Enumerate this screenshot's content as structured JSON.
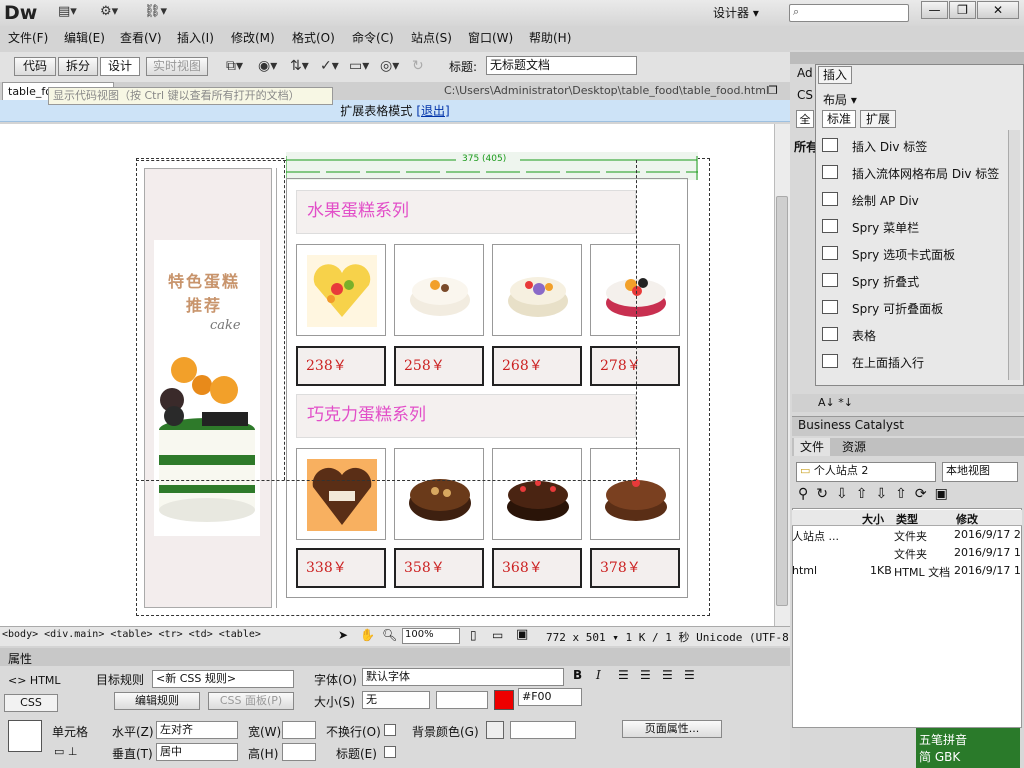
{
  "app": {
    "logo": "Dw",
    "workspace": "设计器 ▾",
    "search_placeholder": "⌕"
  },
  "window_buttons": {
    "minimize": "—",
    "restore": "❐",
    "close": "✕"
  },
  "menu": [
    "文件(F)",
    "编辑(E)",
    "查看(V)",
    "插入(I)",
    "修改(M)",
    "格式(O)",
    "命令(C)",
    "站点(S)",
    "窗口(W)",
    "帮助(H)"
  ],
  "view_buttons": {
    "code": "代码",
    "split": "拆分",
    "design": "设计",
    "live": "实时视图"
  },
  "title_field": {
    "label": "标题:",
    "value": "无标题文档"
  },
  "doc_tab": {
    "name": "table_food.html",
    "close": "×"
  },
  "tooltip": "显示代码视图（按 Ctrl 键以查看所有打开的文档）",
  "file_path": "C:\\Users\\Administrator\\Desktop\\table_food\\table_food.html",
  "expanded_bar": {
    "text": "扩展表格模式",
    "exit": "[退出]"
  },
  "ruler_label": "375 (405)",
  "promo": {
    "line1": "特色蛋糕",
    "line2": "推荐",
    "line3": "cake"
  },
  "sections": [
    {
      "title": "水果蛋糕系列",
      "prices": [
        "238￥",
        "258￥",
        "268￥",
        "278￥"
      ]
    },
    {
      "title": "巧克力蛋糕系列",
      "prices": [
        "338￥",
        "358￥",
        "368￥",
        "378￥"
      ]
    }
  ],
  "status": {
    "tag_path": "<body> <div.main> <table> <tr> <td> <table>",
    "zoom": "100%",
    "size": "772 x 501 ▾  1 K / 1 秒  Unicode (UTF-8)"
  },
  "properties": {
    "header": "属性",
    "html_tab": "<> HTML",
    "css_tab": "CSS",
    "target_rule_label": "目标规则",
    "target_rule_value": "<新 CSS 规则>",
    "edit_rule": "编辑规则",
    "css_panel": "CSS 面板(P)",
    "font_label": "字体(O)",
    "font_value": "默认字体",
    "size_label": "大小(S)",
    "size_value": "无",
    "color_value": "#F00",
    "cell_label": "单元格",
    "horz_label": "水平(Z)",
    "horz_value": "左对齐",
    "vert_label": "垂直(T)",
    "vert_value": "居中",
    "width_label": "宽(W)",
    "height_label": "高(H)",
    "nowrap_label": "不换行(O)",
    "header_label": "标题(E)",
    "bg_label": "背景颜色(G)",
    "page_props": "页面属性..."
  },
  "insert_panel": {
    "tab": "插入",
    "category": "布局 ▾",
    "mode_standard": "标准",
    "mode_expanded": "扩展",
    "items": [
      "插入 Div 标签",
      "插入流体网格布局 Div 标签",
      "绘制 AP Div",
      "Spry 菜单栏",
      "Spry 选项卡式面板",
      "Spry 折叠式",
      "Spry 可折叠面板",
      "表格",
      "在上面插入行"
    ]
  },
  "side_tabs": {
    "ad": "Ad",
    "cs": "CS",
    "all": "全",
    "all_label": "所有"
  },
  "business_catalyst": "Business Catalyst",
  "files_panel": {
    "tab_files": "文件",
    "tab_assets": "资源",
    "site": "个人站点 2",
    "view": "本地视图",
    "headers": [
      "大小",
      "类型",
      "修改"
    ],
    "rows": [
      {
        "name": "人站点 ...",
        "size": "",
        "type": "文件夹",
        "date": "2016/9/17 2"
      },
      {
        "name": "",
        "size": "",
        "type": "文件夹",
        "date": "2016/9/17 1"
      },
      {
        "name": "html",
        "size": "1KB",
        "type": "HTML 文档",
        "date": "2016/9/17 1"
      }
    ]
  },
  "ime": {
    "name": "五笔拼音",
    "line2": "简 GBK"
  },
  "colors": {
    "price": "#cc2222",
    "section_title": "#e24ec8",
    "promo": "#c8946c",
    "expanded_bar": "#cde3f7"
  }
}
